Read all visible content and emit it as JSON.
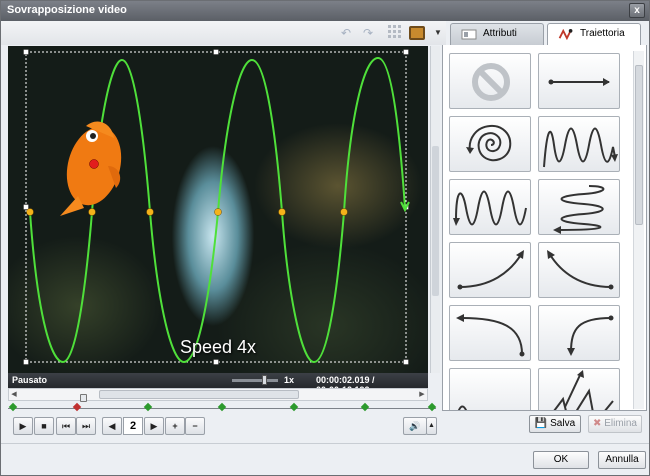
{
  "window": {
    "title": "Sovrapposizione video",
    "close_label": "x"
  },
  "toolbar": {
    "undo_icon": "undo-icon",
    "redo_icon": "redo-icon",
    "grid_icon": "grid-icon",
    "screen_icon": "screen-icon"
  },
  "tabs": [
    {
      "label": "Attributi",
      "active": false
    },
    {
      "label": "Traiettoria",
      "active": true
    }
  ],
  "video": {
    "caption": "Speed 4x",
    "trajectory_color": "#4fe03a",
    "point_color": "#f5b21a"
  },
  "status": {
    "state": "Pausato",
    "speed": "1x",
    "time": "00:00:02.019  /  00:00:12.192"
  },
  "controls": {
    "page": "2"
  },
  "palette": {
    "tiles": [
      {
        "name": "none"
      },
      {
        "name": "straight-line"
      },
      {
        "name": "spiral"
      },
      {
        "name": "wave-vertical"
      },
      {
        "name": "wave-vertical-down"
      },
      {
        "name": "wave-horizontal"
      },
      {
        "name": "curve-up-right"
      },
      {
        "name": "curve-up-left"
      },
      {
        "name": "curve-left-down"
      },
      {
        "name": "curve-up-down"
      },
      {
        "name": "wave-bottom"
      },
      {
        "name": "zigzag-up"
      }
    ]
  },
  "buttons": {
    "save": "Salva",
    "delete": "Elimina",
    "ok": "OK",
    "cancel": "Annulla"
  }
}
